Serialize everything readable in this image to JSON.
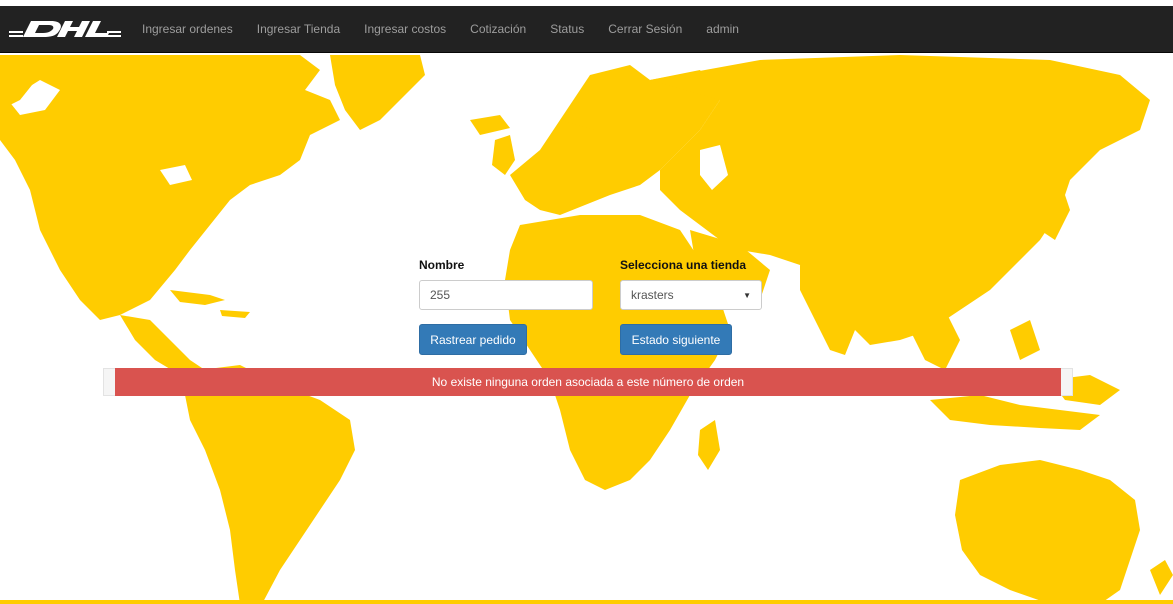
{
  "brand": {
    "logo_text": "DHL",
    "logo_color": "#ffffff"
  },
  "nav": {
    "items": [
      {
        "label": "Ingresar ordenes"
      },
      {
        "label": "Ingresar Tienda"
      },
      {
        "label": "Ingresar costos"
      },
      {
        "label": "Cotización"
      },
      {
        "label": "Status"
      },
      {
        "label": "Cerrar Sesión"
      },
      {
        "label": "admin"
      }
    ]
  },
  "form": {
    "nombre_label": "Nombre",
    "nombre_value": "255",
    "tienda_label": "Selecciona una tienda",
    "tienda_selected": "krasters",
    "rastrear_button": "Rastrear pedido",
    "estado_button": "Estado siguiente"
  },
  "alert": {
    "message": "No existe ninguna orden asociada a este número de orden"
  },
  "colors": {
    "map_land": "#ffcc00",
    "navbar_bg": "#222222",
    "button_primary": "#337ab7",
    "alert_danger": "#d9534f"
  }
}
